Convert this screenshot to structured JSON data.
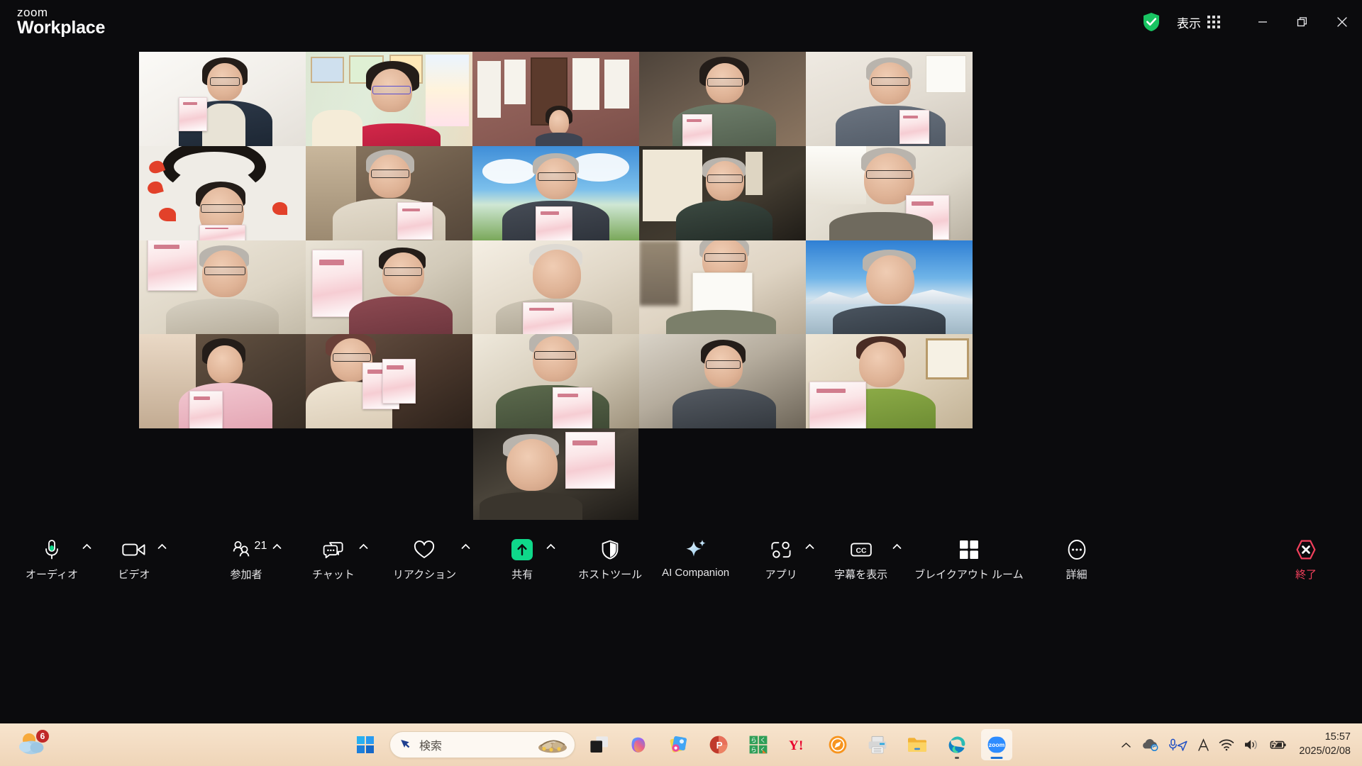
{
  "app": {
    "brand_line1": "zoom",
    "brand_line2": "Workplace"
  },
  "titlebar": {
    "security_icon": "shield-check-icon",
    "view_label": "表示",
    "view_grid_icon": "grid-apps-icon",
    "minimize_label": "最小化",
    "maximize_label": "最大化",
    "close_label": "閉じる"
  },
  "colors": {
    "accent_green": "#0fd88a",
    "active_speaker_border": "#35e08a",
    "end_red": "#f2405c",
    "shield_green": "#19c462",
    "window_bg": "#0b0b0d",
    "taskbar_bg": "#f3dcc2"
  },
  "gallery": {
    "layout": "5x4-plus-1",
    "active_speaker_index": 1,
    "tiles": [
      {
        "id": "tile-1",
        "row": 1,
        "col": 1,
        "desc": "man-with-headset-holding-booklet",
        "active": false
      },
      {
        "id": "tile-2",
        "row": 1,
        "col": 2,
        "desc": "smiling-man-headset-pictures-wall",
        "active": true
      },
      {
        "id": "tile-3",
        "row": 1,
        "col": 3,
        "desc": "man-in-room-with-papers-on-wall",
        "active": false
      },
      {
        "id": "tile-4",
        "row": 1,
        "col": 4,
        "desc": "woman-glasses-holding-booklet",
        "active": false
      },
      {
        "id": "tile-5",
        "row": 1,
        "col": 5,
        "desc": "man-thumbs-up-calendar-wall",
        "active": false
      },
      {
        "id": "tile-6",
        "row": 2,
        "col": 1,
        "desc": "person-with-calligraphy-hearts-background",
        "active": false
      },
      {
        "id": "tile-7",
        "row": 2,
        "col": 2,
        "desc": "man-glasses-holding-php-booklet",
        "active": false
      },
      {
        "id": "tile-8",
        "row": 2,
        "col": 3,
        "desc": "man-with-sky-clouds-virtual-background",
        "active": false
      },
      {
        "id": "tile-9",
        "row": 2,
        "col": 4,
        "desc": "man-glasses-scroll-background",
        "active": false
      },
      {
        "id": "tile-10",
        "row": 2,
        "col": 5,
        "desc": "elderly-man-holding-booklet-window-light",
        "active": false
      },
      {
        "id": "tile-11",
        "row": 3,
        "col": 1,
        "desc": "man-glasses-showing-booklet-closeup",
        "active": false
      },
      {
        "id": "tile-12",
        "row": 3,
        "col": 2,
        "desc": "man-holding-php-2-magazine",
        "active": false
      },
      {
        "id": "tile-13",
        "row": 3,
        "col": 3,
        "desc": "elderly-man-white-hair-booklet",
        "active": false
      },
      {
        "id": "tile-14",
        "row": 3,
        "col": 4,
        "desc": "man-holding-paper-to-camera",
        "active": false
      },
      {
        "id": "tile-15",
        "row": 3,
        "col": 5,
        "desc": "man-with-snow-mountain-background",
        "active": false
      },
      {
        "id": "tile-16",
        "row": 4,
        "col": 1,
        "desc": "woman-in-pink-holding-booklet",
        "active": false
      },
      {
        "id": "tile-17",
        "row": 4,
        "col": 2,
        "desc": "woman-glasses-holding-two-booklets",
        "active": false
      },
      {
        "id": "tile-18",
        "row": 4,
        "col": 3,
        "desc": "elderly-man-green-shirt-holding-php",
        "active": false
      },
      {
        "id": "tile-19",
        "row": 4,
        "col": 4,
        "desc": "man-with-headset-dark-room",
        "active": false
      },
      {
        "id": "tile-20",
        "row": 4,
        "col": 5,
        "desc": "woman-green-sweater-holding-php-2",
        "active": false
      },
      {
        "id": "tile-21",
        "row": 5,
        "col": 3,
        "desc": "elderly-man-holding-php-2-magazine",
        "active": false
      }
    ]
  },
  "toolbar": {
    "items": [
      {
        "key": "audio",
        "icon": "microphone-icon",
        "label": "オーディオ",
        "has_caret": true,
        "badge": null
      },
      {
        "key": "video",
        "icon": "video-camera-icon",
        "label": "ビデオ",
        "has_caret": true,
        "badge": null
      },
      {
        "key": "participants",
        "icon": "participants-icon",
        "label": "参加者",
        "has_caret": true,
        "badge": "21"
      },
      {
        "key": "chat",
        "icon": "chat-bubble-icon",
        "label": "チャット",
        "has_caret": true,
        "badge": null
      },
      {
        "key": "reactions",
        "icon": "heart-icon",
        "label": "リアクション",
        "has_caret": true,
        "badge": null
      },
      {
        "key": "share",
        "icon": "share-screen-icon",
        "label": "共有",
        "has_caret": true,
        "badge": null
      },
      {
        "key": "hosttools",
        "icon": "shield-host-icon",
        "label": "ホストツール",
        "has_caret": false,
        "badge": null
      },
      {
        "key": "aicompanion",
        "icon": "sparkle-ai-icon",
        "label": "AI Companion",
        "has_caret": false,
        "badge": null
      },
      {
        "key": "apps",
        "icon": "apps-icon",
        "label": "アプリ",
        "has_caret": true,
        "badge": null
      },
      {
        "key": "captions",
        "icon": "closed-caption-icon",
        "label": "字幕を表示",
        "has_caret": true,
        "badge": null
      },
      {
        "key": "breakout",
        "icon": "breakout-rooms-icon",
        "label": "ブレイクアウト ルーム",
        "has_caret": false,
        "badge": null
      },
      {
        "key": "more",
        "icon": "ellipsis-icon",
        "label": "詳細",
        "has_caret": false,
        "badge": null
      }
    ],
    "end_button": {
      "icon": "end-call-icon",
      "label": "終了"
    }
  },
  "taskbar": {
    "weather": {
      "icon": "weather-sun-cloud-icon",
      "badge": "6"
    },
    "start": {
      "icon": "windows-logo-icon",
      "label": "スタート"
    },
    "search": {
      "icon": "search-cursor-icon",
      "placeholder": "検索",
      "value": ""
    },
    "apps": [
      {
        "key": "taskview",
        "icon": "task-view-icon",
        "label": "タスク ビュー",
        "running": false,
        "active": false
      },
      {
        "key": "copilot",
        "icon": "copilot-icon",
        "label": "Copilot",
        "running": false,
        "active": false
      },
      {
        "key": "photos",
        "icon": "photos-icon",
        "label": "フォト",
        "running": false,
        "active": false
      },
      {
        "key": "powerpoint",
        "icon": "powerpoint-icon",
        "label": "PowerPoint",
        "running": false,
        "active": false
      },
      {
        "key": "rakuraku",
        "icon": "green-app-icon",
        "label": "らくらく",
        "running": false,
        "active": false
      },
      {
        "key": "yahoo",
        "icon": "yahoo-icon",
        "label": "Yahoo!",
        "running": false,
        "active": false
      },
      {
        "key": "compass",
        "icon": "orange-compass-icon",
        "label": "コンパス",
        "running": false,
        "active": false
      },
      {
        "key": "printer",
        "icon": "printer-icon",
        "label": "プリンター",
        "running": false,
        "active": false
      },
      {
        "key": "explorer",
        "icon": "folder-icon",
        "label": "エクスプローラー",
        "running": false,
        "active": false
      },
      {
        "key": "edge",
        "icon": "edge-icon",
        "label": "Microsoft Edge",
        "running": true,
        "active": false
      },
      {
        "key": "zoom",
        "icon": "zoom-icon",
        "label": "Zoom",
        "running": true,
        "active": true
      }
    ],
    "tray": [
      {
        "key": "overflow",
        "icon": "chevron-up-icon",
        "label": "隠れているインジケーター"
      },
      {
        "key": "onedrive",
        "icon": "onedrive-sync-icon",
        "label": "OneDrive"
      },
      {
        "key": "micloc",
        "icon": "mic-location-icon",
        "label": "マイクと位置情報"
      },
      {
        "key": "ime",
        "icon": "ime-a-icon",
        "label": "IME"
      },
      {
        "key": "wifi",
        "icon": "wifi-icon",
        "label": "ネットワーク"
      },
      {
        "key": "volume",
        "icon": "speaker-icon",
        "label": "音量"
      },
      {
        "key": "battery",
        "icon": "battery-charging-icon",
        "label": "バッテリー"
      }
    ],
    "clock": {
      "time": "15:57",
      "date": "2025/02/08"
    }
  }
}
